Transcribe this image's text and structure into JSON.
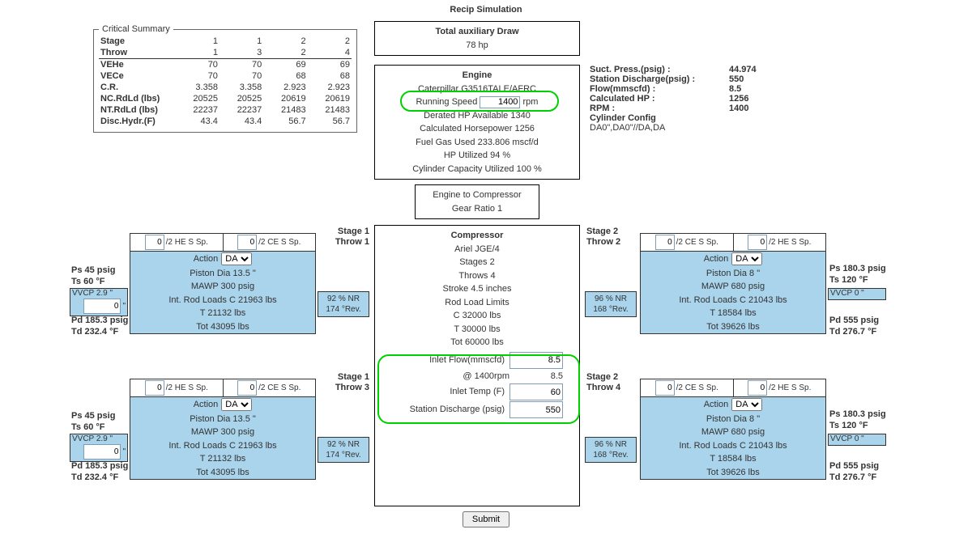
{
  "title": "Recip Simulation",
  "critical": {
    "legend": "Critical Summary",
    "rows": {
      "stage": {
        "label": "Stage",
        "v": [
          "1",
          "1",
          "2",
          "2"
        ]
      },
      "throw": {
        "label": "Throw",
        "v": [
          "1",
          "3",
          "2",
          "4"
        ]
      },
      "vehe": {
        "label": "VEHe",
        "v": [
          "70",
          "70",
          "69",
          "69"
        ]
      },
      "vece": {
        "label": "VECe",
        "v": [
          "70",
          "70",
          "68",
          "68"
        ]
      },
      "cr": {
        "label": "C.R.",
        "v": [
          "3.358",
          "3.358",
          "2.923",
          "2.923"
        ]
      },
      "ncrdld": {
        "label": "NC.RdLd (lbs)",
        "v": [
          "20525",
          "20525",
          "20619",
          "20619"
        ]
      },
      "ntrdld": {
        "label": "NT.RdLd (lbs)",
        "v": [
          "22237",
          "22237",
          "21483",
          "21483"
        ]
      },
      "disch": {
        "label": "Disc.Hydr.(F)",
        "v": [
          "43.4",
          "43.4",
          "56.7",
          "56.7"
        ]
      }
    }
  },
  "aux": {
    "title": "Total auxiliary Draw",
    "value": "78 hp"
  },
  "engine": {
    "title": "Engine",
    "model": "Caterpillar G3516TALE/AFRC",
    "running_speed_label": "Running Speed",
    "running_speed_value": "1400",
    "running_speed_unit": "rpm",
    "derated": "Derated HP Available 1340",
    "calc_hp": "Calculated Horsepower 1256",
    "fuel": "Fuel Gas Used 233.806 mscf/d",
    "hp_util": "HP Utilized 94 %",
    "cyl_cap": "Cylinder Capacity Utilized 100 %"
  },
  "gearbox": {
    "l1": "Engine to Compressor",
    "l2": "Gear Ratio 1"
  },
  "compressor": {
    "title": "Compressor",
    "model": "Ariel JGE/4",
    "stages": "Stages 2",
    "throws": "Throws 4",
    "stroke": "Stroke 4.5 inches",
    "rodload_title": "Rod Load Limits",
    "c": "C 32000 lbs",
    "t": "T 30000 lbs",
    "tot": "Tot 60000 lbs",
    "inlet_flow_label": "Inlet Flow(mmscfd)",
    "inlet_flow": "8.5",
    "at_rpm": "@ 1400rpm",
    "at_rpm_val": "8.5",
    "inlet_temp_label": "Inlet Temp (F)",
    "inlet_temp": "60",
    "station_disc_label": "Station Discharge (psig)",
    "station_disc": "550"
  },
  "side": {
    "suct_label": "Suct. Press.(psig) :",
    "suct": "44.974",
    "disc_label": "Station Discharge(psig) :",
    "disc": "550",
    "flow_label": "Flow(mmscfd) :",
    "flow": "8.5",
    "hp_label": "Calculated HP :",
    "hp": "1256",
    "rpm_label": "RPM :",
    "rpm": "1400",
    "cfg_label": "Cylinder Config",
    "cfg": "DA0\",DA0\"//DA,DA"
  },
  "throws_common": {
    "he_label": "/2 HE S Sp.",
    "ce_label": "/2 CE S Sp.",
    "vve_val": "0",
    "action_label": "Action",
    "action_value": "DA"
  },
  "throw_left": {
    "piston": "Piston Dia 13.5 \"",
    "mawp": "MAWP  300 psig",
    "irl": "Int. Rod Loads C 21963 lbs",
    "t": "T 21132 lbs",
    "tot": "Tot 43095 lbs",
    "side_l1": "92 % NR",
    "side_l2": "174 °Rev.",
    "ps": "Ps 45 psig",
    "ts": "Ts 60 °F",
    "vvcp_label": "VVCP 2.9 \"",
    "vvcp_input": "0",
    "vvcp_unit": "\"",
    "pd": "Pd 185.3 psig",
    "td": "Td 232.4 °F"
  },
  "throw_right": {
    "piston": "Piston Dia 8 \"",
    "mawp": "MAWP  680 psig",
    "irl": "Int. Rod Loads C 21043 lbs",
    "t": "T 18584 lbs",
    "tot": "Tot 39626 lbs",
    "side_l1": "96 % NR",
    "side_l2": "168 °Rev.",
    "ps": "Ps 180.3 psig",
    "ts": "Ts 120 °F",
    "vvcp_label": "VVCP 0 \"",
    "pd": "Pd 555 psig",
    "td": "Td 276.7 °F"
  },
  "headers": {
    "s1t1_a": "Stage 1",
    "s1t1_b": "Throw 1",
    "s2t2_a": "Stage 2",
    "s2t2_b": "Throw 2",
    "s1t3_a": "Stage 1",
    "s1t3_b": "Throw 3",
    "s2t4_a": "Stage 2",
    "s2t4_b": "Throw 4"
  },
  "submit": "Submit"
}
